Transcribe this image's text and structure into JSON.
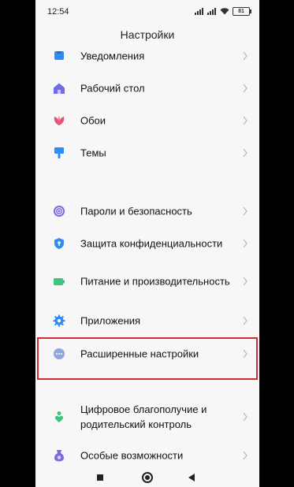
{
  "statusbar": {
    "time": "12:54",
    "battery": "81"
  },
  "header": {
    "title": "Настройки"
  },
  "items": [
    {
      "label": "Уведомления",
      "icon": "notification-icon",
      "color": "#2f8cf2"
    },
    {
      "label": "Рабочий стол",
      "icon": "home-icon",
      "color": "#6d6de6"
    },
    {
      "label": "Обои",
      "icon": "wallpaper-icon",
      "color": "#e8557a"
    },
    {
      "label": "Темы",
      "icon": "theme-icon",
      "color": "#2f8cf2"
    },
    {
      "label": "Пароли и безопасность",
      "icon": "fingerprint-icon",
      "color": "#7b6be0"
    },
    {
      "label": "Защита конфиденциальности",
      "icon": "shield-icon",
      "color": "#2f8cf2"
    },
    {
      "label": "Питание и производительность",
      "icon": "battery-icon",
      "color": "#3fc47a"
    },
    {
      "label": "Приложения",
      "icon": "gear-icon",
      "color": "#2f8cf2"
    },
    {
      "label": "Расширенные настройки",
      "icon": "more-icon",
      "color": "#8fa8d8"
    },
    {
      "label": "Цифровое благополучие и родительский контроль",
      "icon": "wellbeing-icon",
      "color": "#3fc47a"
    },
    {
      "label": "Особые возможности",
      "icon": "accessibility-icon",
      "color": "#7b6be0"
    }
  ],
  "navbar": {
    "recents": "recents-icon",
    "home": "home-button-icon",
    "back": "back-icon"
  }
}
